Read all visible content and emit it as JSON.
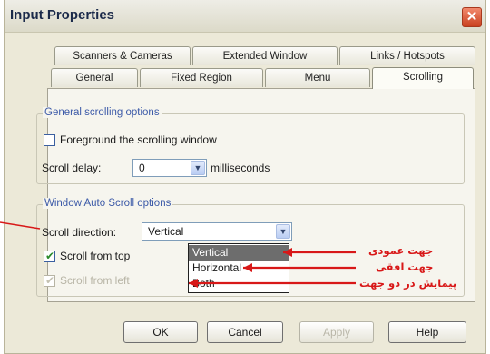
{
  "window": {
    "title": "Input Properties",
    "close_glyph": "✕"
  },
  "tabs": {
    "row_back": [
      "Scanners & Cameras",
      "Extended Window",
      "Links / Hotspots"
    ],
    "row_front": [
      "General",
      "Fixed Region",
      "Menu",
      "Scrolling"
    ],
    "active": "Scrolling"
  },
  "general_group": {
    "title": "General scrolling options",
    "foreground_label": "Foreground the scrolling window",
    "foreground_checked": false,
    "scroll_delay_label": "Scroll delay:",
    "scroll_delay_value": "0",
    "scroll_delay_unit": "milliseconds"
  },
  "auto_group": {
    "title": "Window Auto Scroll options",
    "direction_label": "Scroll direction:",
    "direction_value": "Vertical",
    "direction_options": [
      "Vertical",
      "Horizontal",
      "Both"
    ],
    "highlighted_option": "Vertical",
    "scroll_top_label": "Scroll from top",
    "scroll_top_checked": true,
    "scroll_left_label": "Scroll from left",
    "scroll_left_checked": true,
    "scroll_left_disabled": true
  },
  "buttons": {
    "ok": "OK",
    "cancel": "Cancel",
    "apply": "Apply",
    "help": "Help"
  },
  "annotations": {
    "vertical": "جهت عمودی",
    "horizontal": "جهت افقی",
    "both": "پیمایش در دو جهت",
    "color": "#d81818"
  },
  "icons": {
    "dropdown_arrow": "chevron-down-icon",
    "checkmark": "checkmark-icon",
    "close": "close-icon"
  }
}
